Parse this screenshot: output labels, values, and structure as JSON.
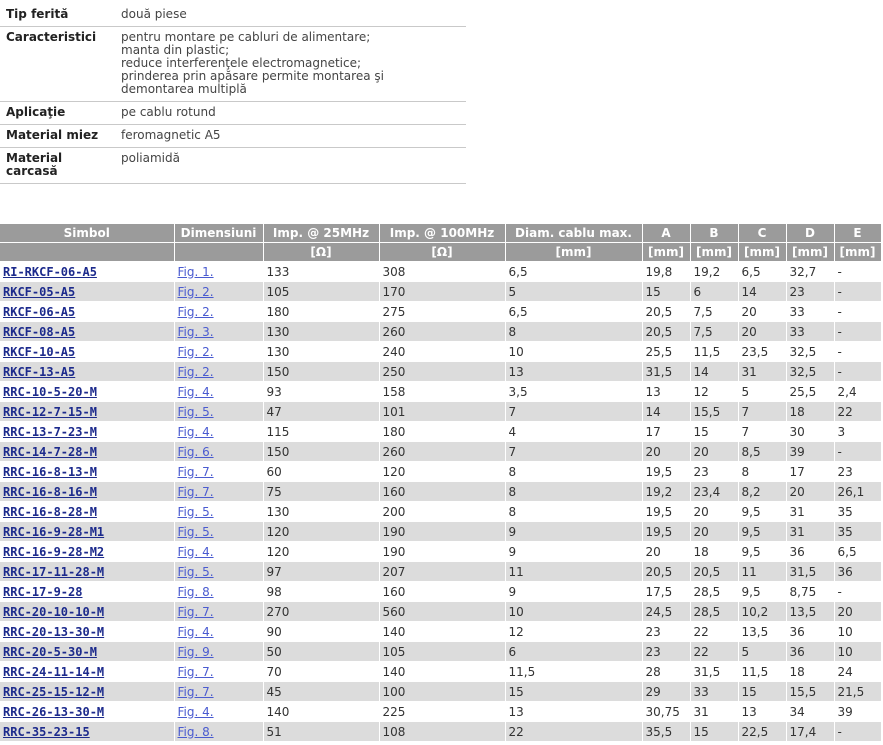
{
  "spec": [
    {
      "label": "Tip ferită",
      "value": [
        "două piese"
      ]
    },
    {
      "label": "Caracteristici",
      "value": [
        "pentru montare pe cabluri de alimentare;",
        "manta din plastic;",
        "reduce interferenţele electromagnetice;",
        "prinderea prin apăsare permite montarea şi demontarea multiplă"
      ]
    },
    {
      "label": "Aplicaţie",
      "value": [
        "pe cablu rotund"
      ]
    },
    {
      "label": "Material miez",
      "value": [
        "feromagnetic A5"
      ]
    },
    {
      "label": "Material carcasă",
      "value": [
        "poliamidă"
      ]
    }
  ],
  "table": {
    "headers": [
      "Simbol",
      "Dimensiuni",
      "Imp. @ 25MHz",
      "Imp. @ 100MHz",
      "Diam. cablu max.",
      "A",
      "B",
      "C",
      "D",
      "E"
    ],
    "units": [
      "",
      "",
      "[Ω]",
      "[Ω]",
      "[mm]",
      "[mm]",
      "[mm]",
      "[mm]",
      "[mm]",
      "[mm]"
    ],
    "rows": [
      [
        "RI-RKCF-06-A5",
        "Fig. 1.",
        "133",
        "308",
        "6,5",
        "19,8",
        "19,2",
        "6,5",
        "32,7",
        "-"
      ],
      [
        "RKCF-05-A5",
        "Fig. 2.",
        "105",
        "170",
        "5",
        "15",
        "6",
        "14",
        "23",
        "-"
      ],
      [
        "RKCF-06-A5",
        "Fig. 2.",
        "180",
        "275",
        "6,5",
        "20,5",
        "7,5",
        "20",
        "33",
        "-"
      ],
      [
        "RKCF-08-A5",
        "Fig. 3.",
        "130",
        "260",
        "8",
        "20,5",
        "7,5",
        "20",
        "33",
        "-"
      ],
      [
        "RKCF-10-A5",
        "Fig. 2.",
        "130",
        "240",
        "10",
        "25,5",
        "11,5",
        "23,5",
        "32,5",
        "-"
      ],
      [
        "RKCF-13-A5",
        "Fig. 2.",
        "150",
        "250",
        "13",
        "31,5",
        "14",
        "31",
        "32,5",
        "-"
      ],
      [
        "RRC-10-5-20-M",
        "Fig. 4.",
        "93",
        "158",
        "3,5",
        "13",
        "12",
        "5",
        "25,5",
        "2,4"
      ],
      [
        "RRC-12-7-15-M",
        "Fig. 5.",
        "47",
        "101",
        "7",
        "14",
        "15,5",
        "7",
        "18",
        "22"
      ],
      [
        "RRC-13-7-23-M",
        "Fig. 4.",
        "115",
        "180",
        "4",
        "17",
        "15",
        "7",
        "30",
        "3"
      ],
      [
        "RRC-14-7-28-M",
        "Fig. 6.",
        "150",
        "260",
        "7",
        "20",
        "20",
        "8,5",
        "39",
        "-"
      ],
      [
        "RRC-16-8-13-M",
        "Fig. 7.",
        "60",
        "120",
        "8",
        "19,5",
        "23",
        "8",
        "17",
        "23"
      ],
      [
        "RRC-16-8-16-M",
        "Fig. 7.",
        "75",
        "160",
        "8",
        "19,2",
        "23,4",
        "8,2",
        "20",
        "26,1"
      ],
      [
        "RRC-16-8-28-M",
        "Fig. 5.",
        "130",
        "200",
        "8",
        "19,5",
        "20",
        "9,5",
        "31",
        "35"
      ],
      [
        "RRC-16-9-28-M1",
        "Fig. 5.",
        "120",
        "190",
        "9",
        "19,5",
        "20",
        "9,5",
        "31",
        "35"
      ],
      [
        "RRC-16-9-28-M2",
        "Fig. 4.",
        "120",
        "190",
        "9",
        "20",
        "18",
        "9,5",
        "36",
        "6,5"
      ],
      [
        "RRC-17-11-28-M",
        "Fig. 5.",
        "97",
        "207",
        "11",
        "20,5",
        "20,5",
        "11",
        "31,5",
        "36"
      ],
      [
        "RRC-17-9-28",
        "Fig. 8.",
        "98",
        "160",
        "9",
        "17,5",
        "28,5",
        "9,5",
        "8,75",
        "-"
      ],
      [
        "RRC-20-10-10-M",
        "Fig. 7.",
        "270",
        "560",
        "10",
        "24,5",
        "28,5",
        "10,2",
        "13,5",
        "20"
      ],
      [
        "RRC-20-13-30-M",
        "Fig. 4.",
        "90",
        "140",
        "12",
        "23",
        "22",
        "13,5",
        "36",
        "10"
      ],
      [
        "RRC-20-5-30-M",
        "Fig. 9.",
        "50",
        "105",
        "6",
        "23",
        "22",
        "5",
        "36",
        "10"
      ],
      [
        "RRC-24-11-14-M",
        "Fig. 7.",
        "70",
        "140",
        "11,5",
        "28",
        "31,5",
        "11,5",
        "18",
        "24"
      ],
      [
        "RRC-25-15-12-M",
        "Fig. 7.",
        "45",
        "100",
        "15",
        "29",
        "33",
        "15",
        "15,5",
        "21,5"
      ],
      [
        "RRC-26-13-30-M",
        "Fig. 4.",
        "140",
        "225",
        "13",
        "30,75",
        "31",
        "13",
        "34",
        "39"
      ],
      [
        "RRC-35-23-15",
        "Fig. 8.",
        "51",
        "108",
        "22",
        "35,5",
        "15",
        "22,5",
        "17,4",
        "-"
      ]
    ]
  },
  "colors": {
    "header_bg": "#9b9b9b",
    "row_alt": "#dcdcdc",
    "symbol_link": "#1c2a8c",
    "fig_link": "#4a5bd0"
  }
}
